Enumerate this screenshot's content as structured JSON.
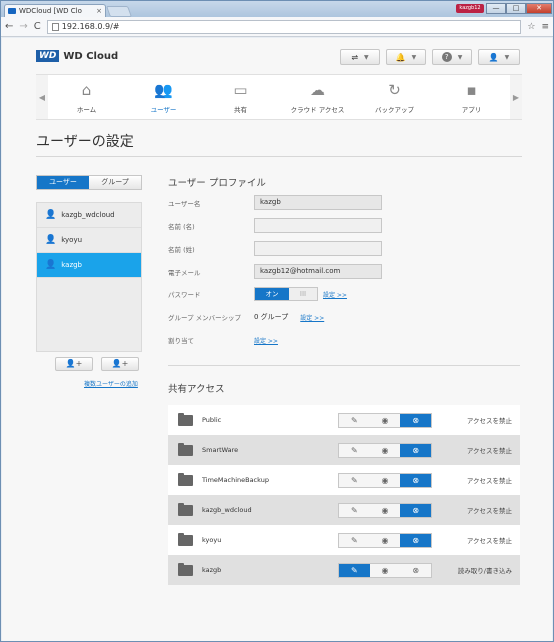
{
  "browser": {
    "tab_title": "WDCloud [WD Clo",
    "tab_close": "×",
    "user_badge": "kazgb12",
    "window_min": "—",
    "window_max": "□",
    "window_close": "✕",
    "nav_back": "←",
    "nav_forward": "→",
    "nav_reload": "C",
    "url": "192.168.0.9/#",
    "star": "☆",
    "menu": "≡"
  },
  "header": {
    "logo_badge": "WD",
    "logo_text": "WD Cloud",
    "btn_usb_icon": "usb-icon",
    "btn_alert_icon": "bell-icon",
    "btn_help": "?",
    "btn_user_icon": "user-icon"
  },
  "nav": {
    "items": [
      {
        "label": "ホーム",
        "icon": "⌂"
      },
      {
        "label": "ユーザー",
        "icon": "👥"
      },
      {
        "label": "共有",
        "icon": "▭"
      },
      {
        "label": "クラウド アクセス",
        "icon": "☁"
      },
      {
        "label": "バックアップ",
        "icon": "↻"
      },
      {
        "label": "アプリ",
        "icon": "▪"
      }
    ],
    "left_arrow": "◀",
    "right_arrow": "▶"
  },
  "page_title": "ユーザーの設定",
  "tabs": {
    "users": "ユーザー",
    "groups": "グループ"
  },
  "users": [
    {
      "name": "kazgb_wdcloud",
      "icon": "👤"
    },
    {
      "name": "kyoyu",
      "icon": "👤"
    },
    {
      "name": "kazgb",
      "icon": "👤"
    }
  ],
  "user_buttons": {
    "add": "👤+",
    "remove": "👤+"
  },
  "add_multiple_link": "複数ユーザーの追加",
  "profile": {
    "title": "ユーザー プロファイル",
    "username_label": "ユーザー名",
    "username": "kazgb",
    "first_name_label": "名前 (名)",
    "first_name": "",
    "last_name_label": "名前 (姓)",
    "last_name": "",
    "email_label": "電子メール",
    "email": "kazgb12@hotmail.com",
    "password_label": "パスワード",
    "password_on": "オン",
    "password_off": "III",
    "settings_link": "設定 >>",
    "group_label": "グループ メンバーシップ",
    "group_value": "0 グループ",
    "quota_label": "割り当て"
  },
  "share_access": {
    "title": "共有アクセス",
    "shares": [
      {
        "name": "Public",
        "access": "deny",
        "status": "アクセスを禁止"
      },
      {
        "name": "SmartWare",
        "access": "deny",
        "status": "アクセスを禁止"
      },
      {
        "name": "TimeMachineBackup",
        "access": "deny",
        "status": "アクセスを禁止"
      },
      {
        "name": "kazgb_wdcloud",
        "access": "deny",
        "status": "アクセスを禁止"
      },
      {
        "name": "kyoyu",
        "access": "deny",
        "status": "アクセスを禁止"
      },
      {
        "name": "kazgb",
        "access": "readwrite",
        "status": "読み取り/書き込み"
      }
    ],
    "icons": {
      "readwrite": "✎",
      "read": "◉",
      "deny": "⊗"
    }
  }
}
